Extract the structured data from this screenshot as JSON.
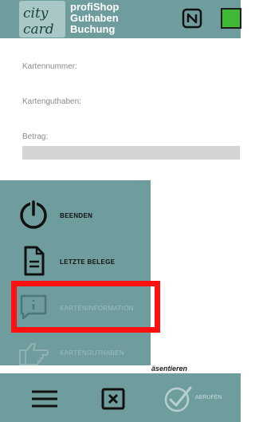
{
  "header": {
    "logo_text_line1": "city",
    "logo_text_line2": "card",
    "title_lines": [
      "profiShop",
      "Guthaben",
      "Buchung"
    ]
  },
  "form": {
    "card_number_label": "Kartennummer:",
    "card_balance_label": "Kartenguthaben:",
    "amount_label": "Betrag:"
  },
  "menu": {
    "items": [
      {
        "label": "BEENDEN",
        "icon": "power-icon",
        "enabled": true
      },
      {
        "label": "LETZTE BELEGE",
        "icon": "document-icon",
        "enabled": true
      },
      {
        "label": "KARTENINFORMATION",
        "icon": "info-message-icon",
        "enabled": false
      },
      {
        "label": "KARTENGUTHABEN",
        "icon": "pointing-hand-icon",
        "enabled": false
      }
    ]
  },
  "background_text": "äsentieren",
  "bottom_bar": {
    "menu_icon": "hamburger-icon",
    "cancel_icon": "close-box-icon",
    "confirm_icon": "checkmark-circle-icon",
    "confirm_label": "ABRUFEN"
  },
  "colors": {
    "header_bg": "#6f9d9d",
    "highlight": "#ff1010",
    "status_green": "#3fb836"
  }
}
